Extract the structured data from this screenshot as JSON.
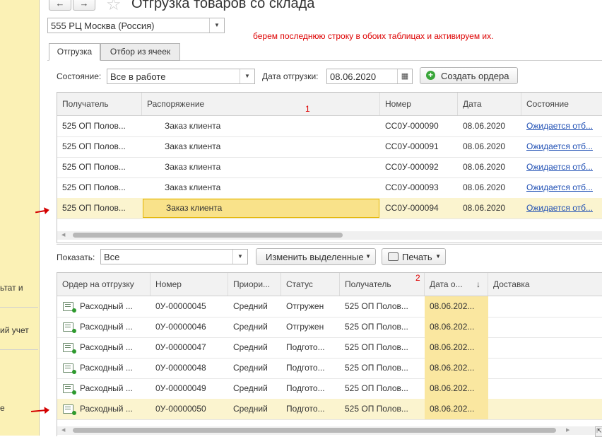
{
  "header": {
    "title": "Отгрузка товаров со склада",
    "back_icon": "arrow-left-icon",
    "forward_icon": "arrow-right-icon",
    "star_icon": "star-icon"
  },
  "sidebar": {
    "fragments": [
      "ьтат и",
      "ий учет",
      "е"
    ]
  },
  "warehouse": {
    "value": "555 РЦ Москва (Россия)"
  },
  "annotation": {
    "text": "берем последнюю строку в обоих таблицах и активируем их.",
    "label1": "1",
    "label2": "2"
  },
  "tabs": [
    {
      "label": "Отгрузка"
    },
    {
      "label": "Отбор из ячеек"
    }
  ],
  "filters": {
    "state_label": "Состояние:",
    "state_value": "Все в работе",
    "date_label": "Дата отгрузки:",
    "date_value": "08.06.2020",
    "create_orders_label": "Создать ордера"
  },
  "table1": {
    "columns": [
      "Получатель",
      "Распоряжение",
      "Номер",
      "Дата",
      "Состояние"
    ],
    "rows": [
      [
        "525 ОП Полов...",
        "Заказ клиента",
        "СС0У-000090",
        "08.06.2020",
        "Ожидается отб..."
      ],
      [
        "525 ОП Полов...",
        "Заказ клиента",
        "СС0У-000091",
        "08.06.2020",
        "Ожидается отб..."
      ],
      [
        "525 ОП Полов...",
        "Заказ клиента",
        "СС0У-000092",
        "08.06.2020",
        "Ожидается отб..."
      ],
      [
        "525 ОП Полов...",
        "Заказ клиента",
        "СС0У-000093",
        "08.06.2020",
        "Ожидается отб..."
      ],
      [
        "525 ОП Полов...",
        "Заказ клиента",
        "СС0У-000094",
        "08.06.2020",
        "Ожидается отб..."
      ]
    ]
  },
  "toolbar2": {
    "show_label": "Показать:",
    "show_value": "Все",
    "change_selected_label": "Изменить выделенные",
    "print_label": "Печать"
  },
  "table2": {
    "columns": [
      "Ордер на отгрузку",
      "Номер",
      "Приори...",
      "Статус",
      "Получатель",
      "Дата о...",
      "Доставка"
    ],
    "sort_indicator": "↓",
    "rows": [
      [
        "Расходный ...",
        "0У-00000045",
        "Средний",
        "Отгружен",
        "525 ОП Полов...",
        "08.06.202...",
        ""
      ],
      [
        "Расходный ...",
        "0У-00000046",
        "Средний",
        "Отгружен",
        "525 ОП Полов...",
        "08.06.202...",
        ""
      ],
      [
        "Расходный ...",
        "0У-00000047",
        "Средний",
        "Подгото...",
        "525 ОП Полов...",
        "08.06.202...",
        ""
      ],
      [
        "Расходный ...",
        "0У-00000048",
        "Средний",
        "Подгото...",
        "525 ОП Полов...",
        "08.06.202...",
        ""
      ],
      [
        "Расходный ...",
        "0У-00000049",
        "Средний",
        "Подгото...",
        "525 ОП Полов...",
        "08.06.202...",
        ""
      ],
      [
        "Расходный ...",
        "0У-00000050",
        "Средний",
        "Подгото...",
        "525 ОП Полов...",
        "08.06.202...",
        ""
      ]
    ]
  },
  "colors": {
    "selection": "#fbf4cf",
    "focus": "#f9e28a",
    "link": "#1f4fb4",
    "annotation": "#dd0000",
    "panel": "#fbf1b5"
  }
}
